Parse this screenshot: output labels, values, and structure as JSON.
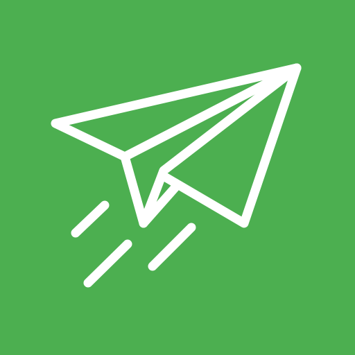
{
  "icon": {
    "name": "paper-plane-icon",
    "background_color": "#4caf50",
    "line_color": "#ffffff",
    "speed_lines": 3
  }
}
